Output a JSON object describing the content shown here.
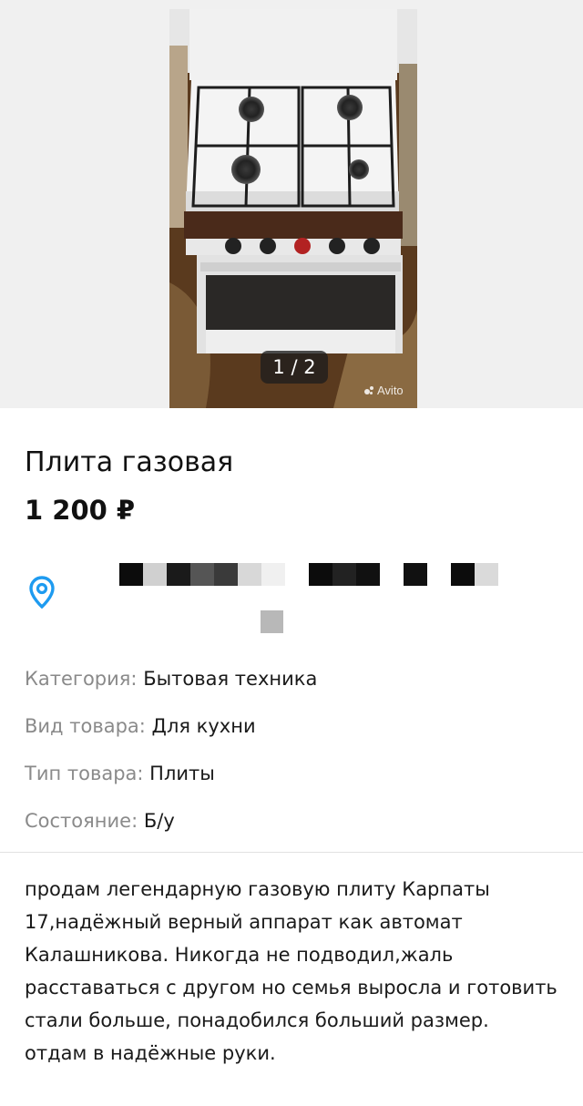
{
  "gallery": {
    "counter": "1 / 2",
    "watermark": "Avito"
  },
  "listing": {
    "title": "Плита газовая",
    "price": "1 200 ₽"
  },
  "location": {
    "icon": "location-pin-icon",
    "address_redacted": true
  },
  "params": [
    {
      "label": "Категория:",
      "value": "Бытовая техника"
    },
    {
      "label": "Вид товара:",
      "value": "Для кухни"
    },
    {
      "label": "Тип товара:",
      "value": "Плиты"
    },
    {
      "label": "Состояние:",
      "value": "Б/у"
    }
  ],
  "description": "продам легендарную газовую плиту Карпаты 17,надёжный верный аппарат как автомат Калашникова. Никогда не подводил,жаль расставаться с другом но семья выросла и готовить стали больше, понадобился больший размер.\nотдам в надёжные руки.",
  "colors": {
    "accent": "#1e9bf0",
    "label_gray": "#8a8a8a"
  }
}
